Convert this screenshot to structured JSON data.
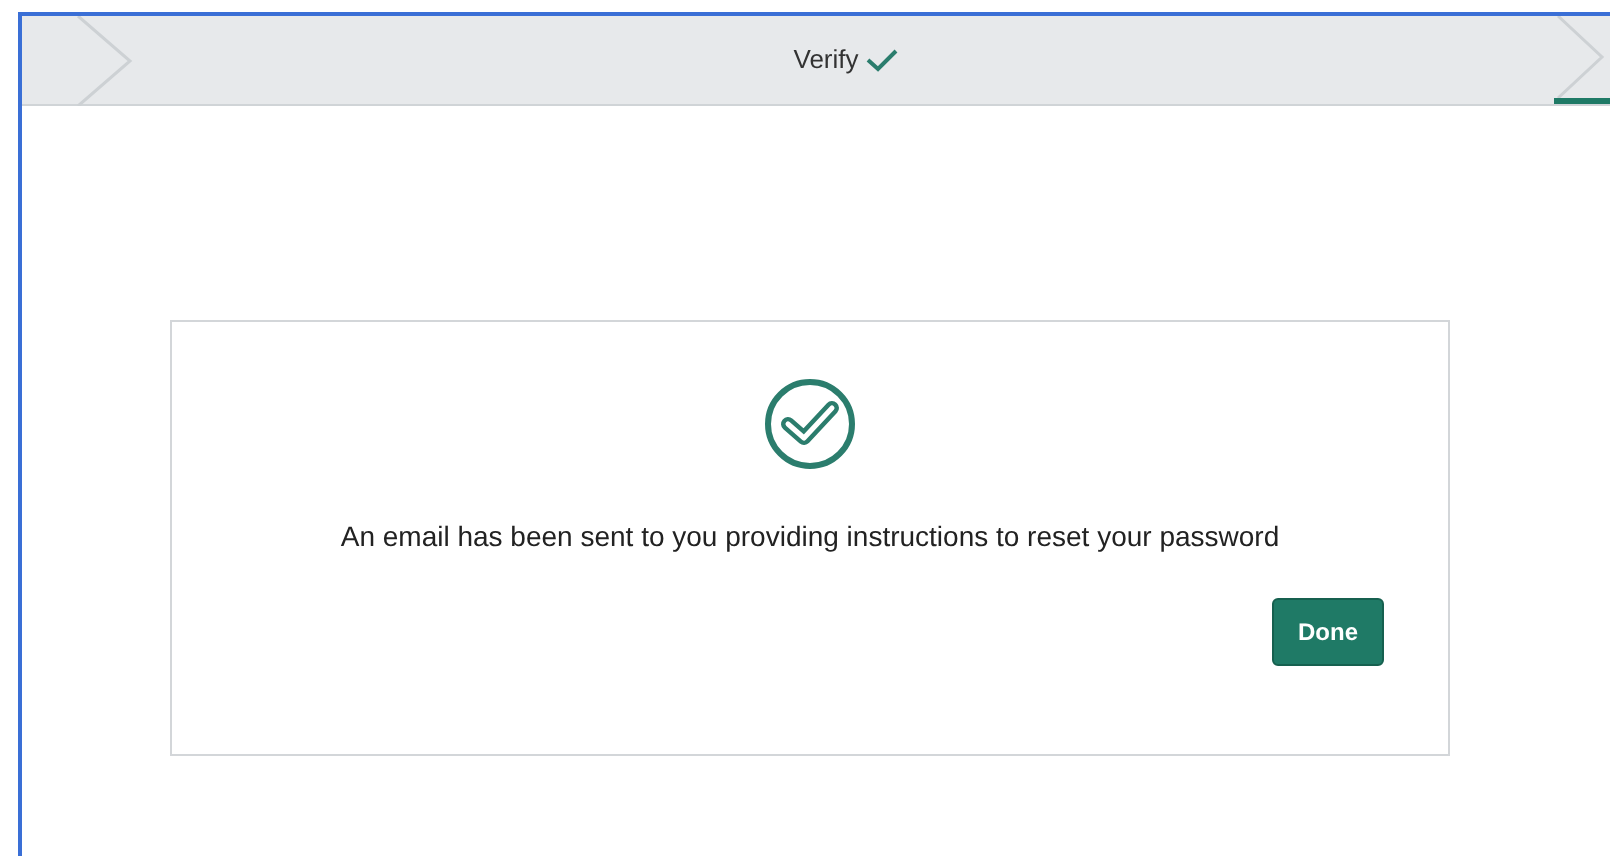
{
  "stepper": {
    "steps": [
      {
        "label": "Verify",
        "completed": true
      }
    ]
  },
  "message": {
    "text": "An email has been sent to you providing instructions to reset your password"
  },
  "buttons": [
    {
      "label": "Done"
    }
  ]
}
